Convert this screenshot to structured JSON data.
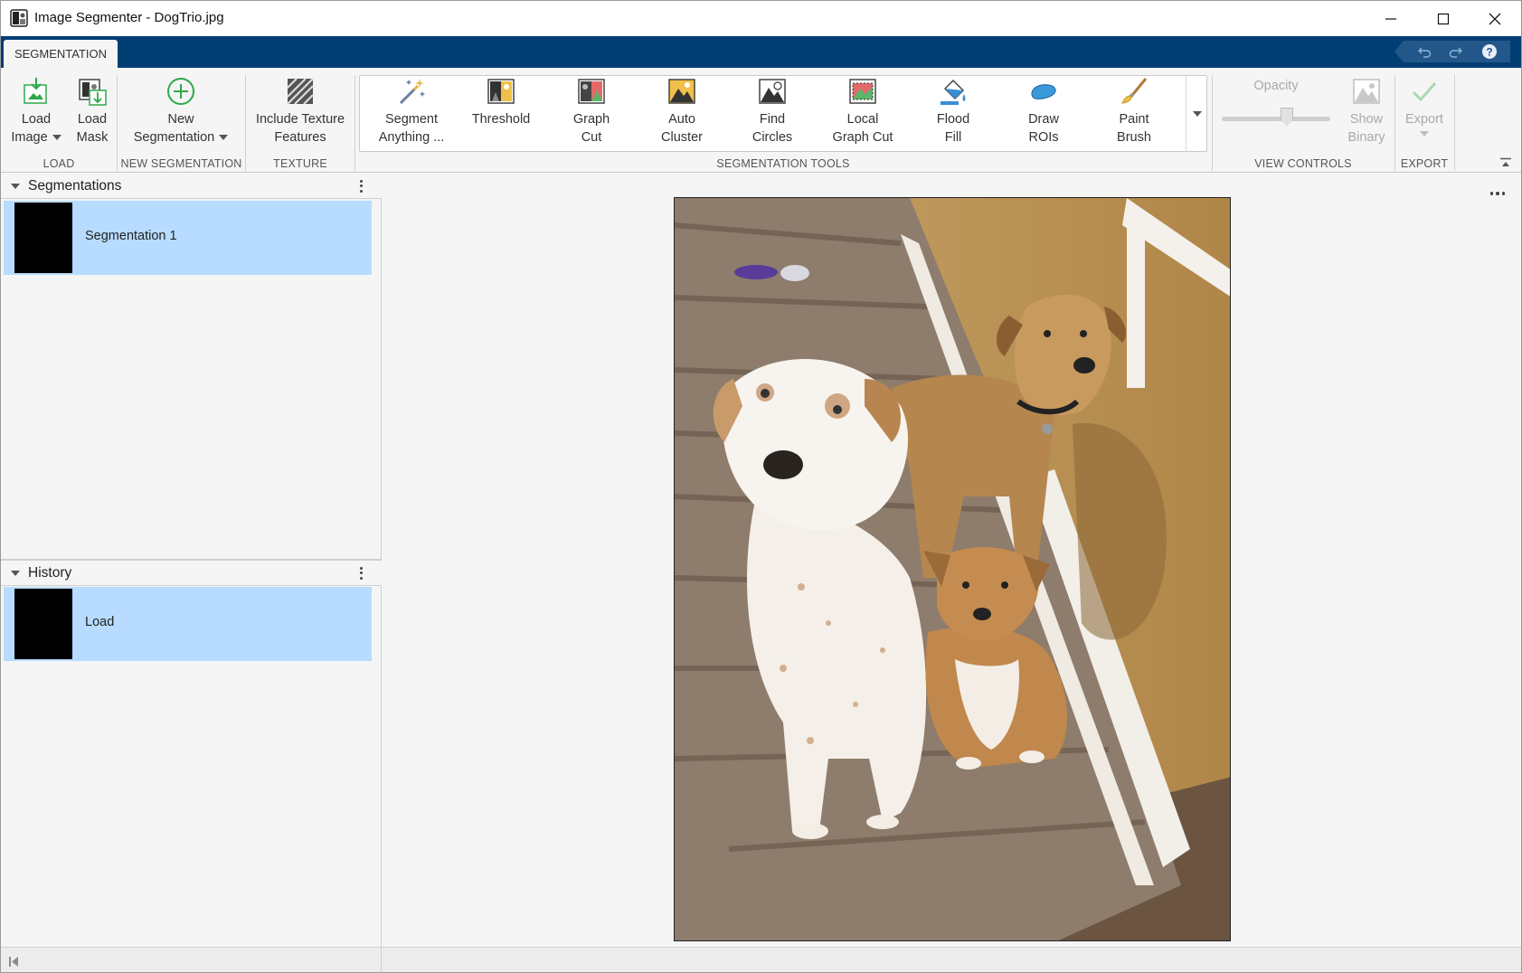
{
  "window": {
    "title": "Image Segmenter - DogTrio.jpg",
    "controls": [
      "minimize",
      "maximize",
      "close"
    ]
  },
  "tabs": [
    {
      "label": "SEGMENTATION",
      "active": true
    }
  ],
  "quick_access": [
    "undo-icon",
    "redo-icon",
    "help-icon"
  ],
  "toolstrip": {
    "load": {
      "section": "LOAD",
      "load_image": {
        "line1": "Load",
        "line2": "Image"
      },
      "load_mask": {
        "line1": "Load",
        "line2": "Mask"
      }
    },
    "new_segmentation": {
      "section": "NEW SEGMENTATION",
      "button": {
        "line1": "New",
        "line2": "Segmentation"
      }
    },
    "texture": {
      "section": "TEXTURE",
      "button": {
        "line1": "Include Texture",
        "line2": "Features"
      }
    },
    "segmentation_tools": {
      "section": "SEGMENTATION TOOLS",
      "items": [
        {
          "line1": "Segment",
          "line2": "Anything ...",
          "icon": "magic-wand-icon"
        },
        {
          "line1": "Threshold",
          "line2": "",
          "icon": "threshold-icon"
        },
        {
          "line1": "Graph",
          "line2": "Cut",
          "icon": "graph-cut-icon"
        },
        {
          "line1": "Auto",
          "line2": "Cluster",
          "icon": "auto-cluster-icon"
        },
        {
          "line1": "Find",
          "line2": "Circles",
          "icon": "find-circles-icon"
        },
        {
          "line1": "Local",
          "line2": "Graph Cut",
          "icon": "local-graph-cut-icon"
        },
        {
          "line1": "Flood",
          "line2": "Fill",
          "icon": "flood-fill-icon"
        },
        {
          "line1": "Draw",
          "line2": "ROIs",
          "icon": "draw-roi-icon"
        },
        {
          "line1": "Paint",
          "line2": "Brush",
          "icon": "paint-brush-icon"
        }
      ]
    },
    "view_controls": {
      "section": "VIEW CONTROLS",
      "opacity_label": "Opacity",
      "opacity_value": 0.6,
      "show_binary": {
        "line1": "Show",
        "line2": "Binary"
      }
    },
    "export": {
      "section": "EXPORT",
      "button": {
        "line1": "Export"
      }
    }
  },
  "segmentations_panel": {
    "title": "Segmentations",
    "items": [
      {
        "label": "Segmentation 1",
        "selected": true
      }
    ]
  },
  "history_panel": {
    "title": "History",
    "items": [
      {
        "label": "Load",
        "selected": true
      }
    ]
  },
  "image": {
    "description_hidden": true
  },
  "colors": {
    "tab_strip": "#003e73",
    "selection": "#b7dcff",
    "accent_green": "#2ea84a"
  }
}
